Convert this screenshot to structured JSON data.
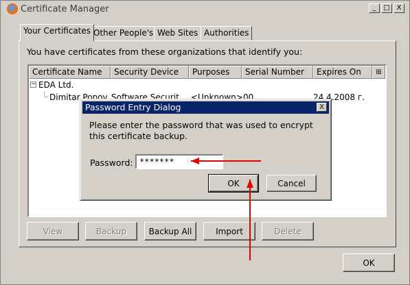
{
  "window": {
    "title": "Certificate Manager",
    "minimize_glyph": "_",
    "maximize_glyph": "□",
    "close_glyph": "X"
  },
  "tabs": [
    {
      "label": "Your Certificates",
      "active": true
    },
    {
      "label": "Other People's",
      "active": false
    },
    {
      "label": "Web Sites",
      "active": false
    },
    {
      "label": "Authorities",
      "active": false
    }
  ],
  "intro_text": "You have certificates from these organizations that identify you:",
  "table": {
    "columns": [
      "Certificate Name",
      "Security Device",
      "Purposes",
      "Serial Number",
      "Expires On"
    ],
    "column_picker_glyph": "⊞",
    "group": {
      "toggle": "−",
      "name": "EDA Ltd."
    },
    "row": {
      "name": "Dimitar Popov",
      "device": "Software Securit...",
      "purposes": "<Unknown>",
      "serial": "00",
      "expires": "24.4.2008 г."
    }
  },
  "buttons": {
    "view": "View",
    "backup": "Backup",
    "backup_all": "Backup All",
    "import": "Import",
    "delete": "Delete",
    "ok": "OK"
  },
  "dialog": {
    "title": "Password Entry Dialog",
    "close_glyph": "X",
    "message": "Please enter the password that was used to encrypt this certificate backup.",
    "password_label": "Password:",
    "password_value": "*******",
    "ok": "OK",
    "cancel": "Cancel"
  },
  "annotation_color": "#e00000"
}
